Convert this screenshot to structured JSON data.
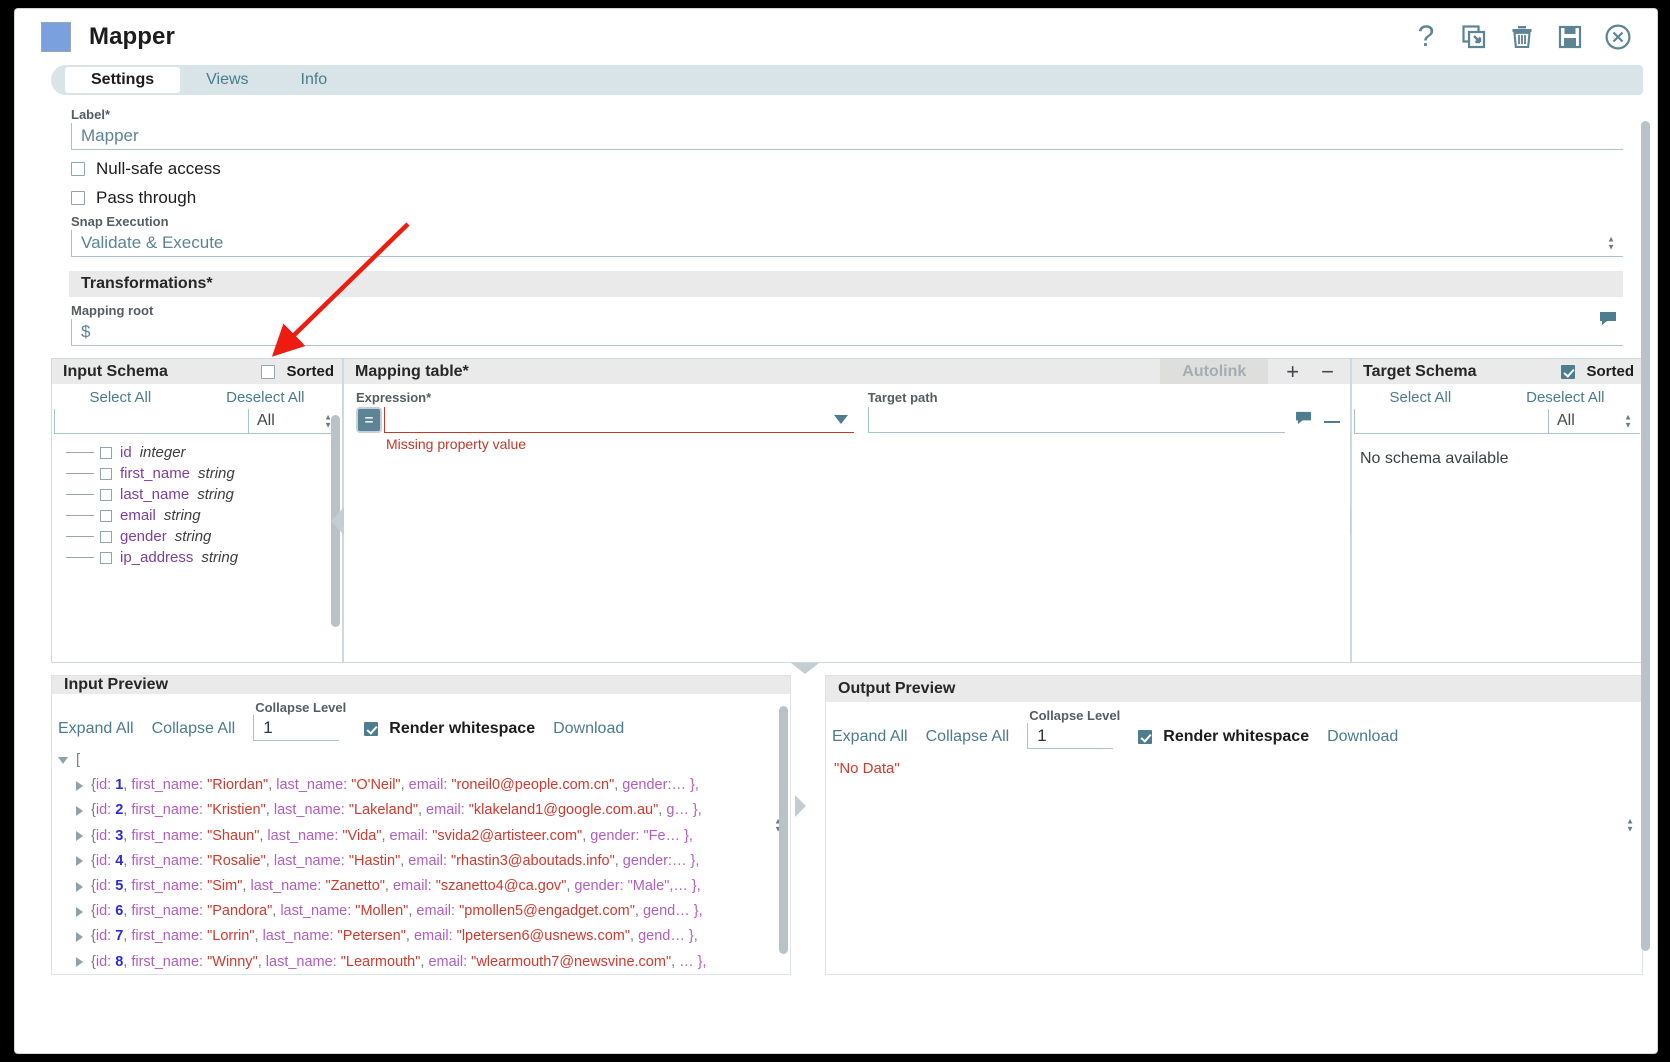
{
  "window": {
    "app_title": "Mapper",
    "icons": [
      {
        "name": "help-icon",
        "glyph": "?"
      },
      {
        "name": "import-icon",
        "glyph": "import"
      },
      {
        "name": "delete-icon",
        "glyph": "trash"
      },
      {
        "name": "save-icon",
        "glyph": "disk"
      },
      {
        "name": "close-icon",
        "glyph": "x-circle"
      }
    ]
  },
  "tabs": [
    {
      "label": "Settings",
      "active": true
    },
    {
      "label": "Views",
      "active": false
    },
    {
      "label": "Info",
      "active": false
    }
  ],
  "settings": {
    "label_field": {
      "label": "Label*",
      "value": "Mapper"
    },
    "null_safe": {
      "label": "Null-safe access",
      "checked": false
    },
    "pass_through": {
      "label": "Pass through",
      "checked": false
    },
    "snap_execution": {
      "label": "Snap Execution",
      "value": "Validate & Execute"
    },
    "transformations_header": "Transformations*",
    "mapping_root": {
      "label": "Mapping root",
      "value": "$"
    }
  },
  "input_schema": {
    "title": "Input Schema",
    "sorted_label": "Sorted",
    "sorted_checked": false,
    "select_all": "Select All",
    "deselect_all": "Deselect All",
    "filter_value": "",
    "filter_type": "All",
    "nodes": [
      {
        "name": "id",
        "type": "integer",
        "checked": false
      },
      {
        "name": "first_name",
        "type": "string",
        "checked": false
      },
      {
        "name": "last_name",
        "type": "string",
        "checked": false
      },
      {
        "name": "email",
        "type": "string",
        "checked": false
      },
      {
        "name": "gender",
        "type": "string",
        "checked": false
      },
      {
        "name": "ip_address",
        "type": "string",
        "checked": false
      }
    ]
  },
  "mapping_table": {
    "title": "Mapping table*",
    "autolink_label": "Autolink",
    "add_label": "+",
    "remove_label": "−",
    "expression_label": "Expression*",
    "expression_value": "",
    "expression_button": "=",
    "error_text": "Missing property value",
    "target_path_label": "Target path",
    "target_path_value": ""
  },
  "target_schema": {
    "title": "Target Schema",
    "sorted_label": "Sorted",
    "sorted_checked": true,
    "select_all": "Select All",
    "deselect_all": "Deselect All",
    "filter_value": "",
    "filter_type": "All",
    "empty_message": "No schema available"
  },
  "input_preview": {
    "title": "Input Preview",
    "expand_all": "Expand All",
    "collapse_all": "Collapse All",
    "collapse_level_label": "Collapse Level",
    "collapse_level_value": "1",
    "render_whitespace_label": "Render whitespace",
    "render_whitespace_checked": true,
    "download": "Download",
    "root_bracket": "[",
    "rows": [
      {
        "id": "1",
        "first_name": "Riordan",
        "last_name": "O'Neil",
        "email": "roneil0@people.com.cn",
        "tail": "gender:… },"
      },
      {
        "id": "2",
        "first_name": "Kristien",
        "last_name": "Lakeland",
        "email": "klakeland1@google.com.au",
        "tail": "g… },"
      },
      {
        "id": "3",
        "first_name": "Shaun",
        "last_name": "Vida",
        "email": "svida2@artisteer.com",
        "tail": "gender: \"Fe… },"
      },
      {
        "id": "4",
        "first_name": "Rosalie",
        "last_name": "Hastin",
        "email": "rhastin3@aboutads.info",
        "tail": "gender:… },"
      },
      {
        "id": "5",
        "first_name": "Sim",
        "last_name": "Zanetto",
        "email": "szanetto4@ca.gov",
        "tail": "gender: \"Male\",… },"
      },
      {
        "id": "6",
        "first_name": "Pandora",
        "last_name": "Mollen",
        "email": "pmollen5@engadget.com",
        "tail": "gend… },"
      },
      {
        "id": "7",
        "first_name": "Lorrin",
        "last_name": "Petersen",
        "email": "lpetersen6@usnews.com",
        "tail": "gend… },"
      },
      {
        "id": "8",
        "first_name": "Winny",
        "last_name": "Learmouth",
        "email": "wlearmouth7@newsvine.com",
        "tail": "… },"
      }
    ],
    "keys": {
      "id": "id:",
      "first_name": "first_name:",
      "last_name": "last_name:",
      "email": "email:"
    }
  },
  "output_preview": {
    "title": "Output Preview",
    "expand_all": "Expand All",
    "collapse_all": "Collapse All",
    "collapse_level_label": "Collapse Level",
    "collapse_level_value": "1",
    "render_whitespace_label": "Render whitespace",
    "render_whitespace_checked": true,
    "download": "Download",
    "empty_message": "\"No Data\""
  }
}
